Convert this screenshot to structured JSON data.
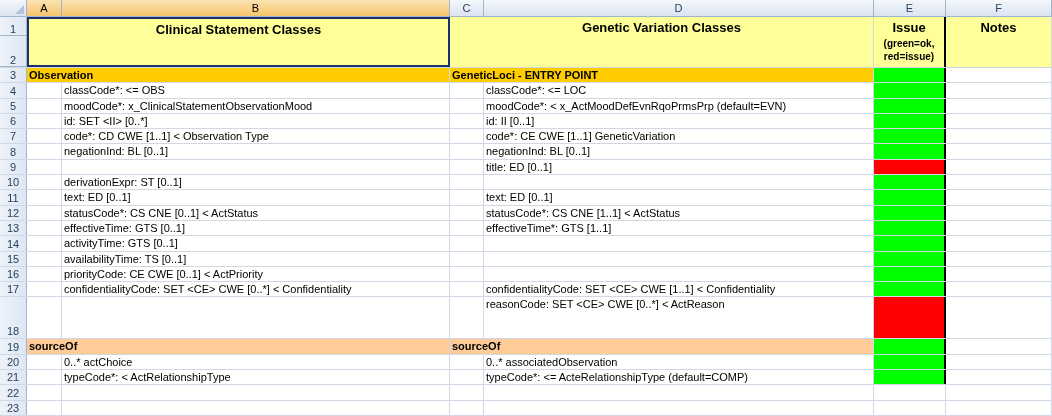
{
  "columns": [
    {
      "label": "A",
      "selected": true
    },
    {
      "label": "B",
      "selected": true
    },
    {
      "label": "C",
      "selected": false
    },
    {
      "label": "D",
      "selected": false
    },
    {
      "label": "E",
      "selected": false
    },
    {
      "label": "F",
      "selected": false
    }
  ],
  "rows": [
    {
      "kind": "header",
      "numbers": [
        "1",
        "2"
      ],
      "left": "Clinical Statement Classes",
      "right": "Genetic Variation Classes",
      "issue_title": "Issue",
      "issue_note": "(green=ok, red=issue)",
      "notes_title": "Notes"
    },
    {
      "kind": "section",
      "number": "3",
      "color": "#ffcc00",
      "left": "Observation",
      "right": "GeneticLoci - ENTRY POINT",
      "flagged": false
    },
    {
      "kind": "field",
      "number": "4",
      "left": "classCode*: <= OBS",
      "right": "classCode*: <= LOC",
      "flagged": false
    },
    {
      "kind": "field",
      "number": "5",
      "left": "moodCode*: x_ClinicalStatementObservationMood",
      "right": "moodCode*: < x_ActMoodDefEvnRqoPrmsPrp (default=EVN)",
      "flagged": false
    },
    {
      "kind": "field",
      "number": "6",
      "left": "id: SET <II> [0..*]",
      "right": "id: II [0..1]",
      "flagged": false
    },
    {
      "kind": "field",
      "number": "7",
      "left": "code*: CD CWE [1..1] < Observation Type",
      "right": "code*: CE CWE [1..1] GeneticVariation",
      "flagged": false
    },
    {
      "kind": "field",
      "number": "8",
      "left": "negationInd: BL [0..1]",
      "right": "negationInd: BL [0..1]",
      "flagged": false
    },
    {
      "kind": "field",
      "number": "9",
      "right": "title: ED [0..1]",
      "flagged": true
    },
    {
      "kind": "field",
      "number": "10",
      "left": "derivationExpr: ST [0..1]",
      "flagged": false
    },
    {
      "kind": "field",
      "number": "11",
      "left": "text: ED [0..1]",
      "right": "text: ED [0..1]",
      "flagged": false
    },
    {
      "kind": "field",
      "number": "12",
      "left": "statusCode*: CS CNE [0..1] < ActStatus",
      "right": "statusCode*: CS CNE [1..1] < ActStatus",
      "flagged": false
    },
    {
      "kind": "field",
      "number": "13",
      "left": "effectiveTime: GTS [0..1]",
      "right": "effectiveTime*: GTS [1..1]",
      "flagged": false
    },
    {
      "kind": "field",
      "number": "14",
      "left": "activityTime: GTS [0..1]",
      "flagged": false
    },
    {
      "kind": "field",
      "number": "15",
      "left": "availabilityTime: TS [0..1]",
      "flagged": false
    },
    {
      "kind": "field",
      "number": "16",
      "left": "priorityCode: CE CWE [0..1] < ActPriority",
      "flagged": false
    },
    {
      "kind": "field",
      "number": "17",
      "left": "confidentialityCode: SET <CE> CWE [0..*] < Confidentiality",
      "right": "confidentialityCode: SET <CE> CWE [1..1] < Confidentiality",
      "flagged": false
    },
    {
      "kind": "tall",
      "number": "18",
      "right": "reasonCode: SET <CE> CWE [0..*] < ActReason",
      "flagged": true
    },
    {
      "kind": "section",
      "number": "19",
      "color": "#ffcc99",
      "left": "sourceOf",
      "right": "sourceOf",
      "flagged": false
    },
    {
      "kind": "field",
      "number": "20",
      "left": "0..* actChoice",
      "right": "0..* associatedObservation",
      "flagged": false
    },
    {
      "kind": "field",
      "number": "21",
      "left": "typeCode*: < ActRelationshipType",
      "right": "typeCode*: <= ActeRelationshipType (default=COMP)",
      "flagged": false
    },
    {
      "kind": "field",
      "number": "22"
    },
    {
      "kind": "field",
      "number": "23"
    }
  ]
}
